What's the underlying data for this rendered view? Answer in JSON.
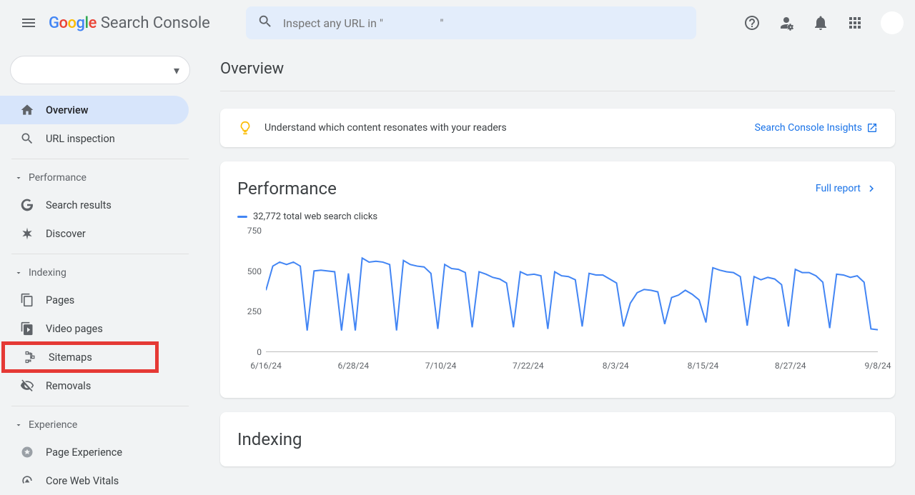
{
  "header": {
    "logo_sc": "Search Console",
    "search_placeholder": "Inspect any URL in \"                    \""
  },
  "sidebar": {
    "property_label": "",
    "items_top": [
      {
        "label": "Overview",
        "active": true
      },
      {
        "label": "URL inspection"
      }
    ],
    "section_performance": "Performance",
    "items_performance": [
      {
        "label": "Search results"
      },
      {
        "label": "Discover"
      }
    ],
    "section_indexing": "Indexing",
    "items_indexing": [
      {
        "label": "Pages"
      },
      {
        "label": "Video pages"
      },
      {
        "label": "Sitemaps",
        "highlighted": true
      },
      {
        "label": "Removals"
      }
    ],
    "section_experience": "Experience",
    "items_experience": [
      {
        "label": "Page Experience"
      },
      {
        "label": "Core Web Vitals"
      }
    ]
  },
  "page": {
    "title": "Overview"
  },
  "insights": {
    "text": "Understand which content resonates with your readers",
    "link": "Search Console Insights"
  },
  "performance": {
    "title": "Performance",
    "full_report": "Full report",
    "legend": "32,772 total web search clicks"
  },
  "indexing_card": {
    "title": "Indexing"
  },
  "chart_data": {
    "type": "line",
    "title": "",
    "xlabel": "",
    "ylabel": "",
    "ylim": [
      0,
      750
    ],
    "x_ticks": [
      "6/16/24",
      "6/28/24",
      "7/10/24",
      "7/22/24",
      "8/3/24",
      "8/15/24",
      "8/27/24",
      "9/8/24"
    ],
    "y_ticks": [
      0,
      250,
      500,
      750
    ],
    "series": [
      {
        "name": "total web search clicks",
        "color": "#4285F4",
        "values": [
          380,
          530,
          555,
          540,
          555,
          530,
          130,
          500,
          505,
          500,
          495,
          130,
          485,
          130,
          580,
          555,
          560,
          555,
          540,
          130,
          565,
          540,
          530,
          525,
          485,
          140,
          540,
          515,
          510,
          490,
          150,
          495,
          480,
          460,
          450,
          425,
          150,
          495,
          475,
          480,
          470,
          140,
          495,
          470,
          465,
          445,
          155,
          485,
          475,
          475,
          450,
          425,
          155,
          300,
          365,
          385,
          380,
          370,
          170,
          335,
          350,
          380,
          355,
          320,
          180,
          520,
          505,
          495,
          490,
          465,
          160,
          465,
          445,
          460,
          450,
          415,
          155,
          510,
          490,
          490,
          470,
          430,
          145,
          480,
          475,
          460,
          470,
          430,
          140,
          135
        ]
      }
    ]
  }
}
